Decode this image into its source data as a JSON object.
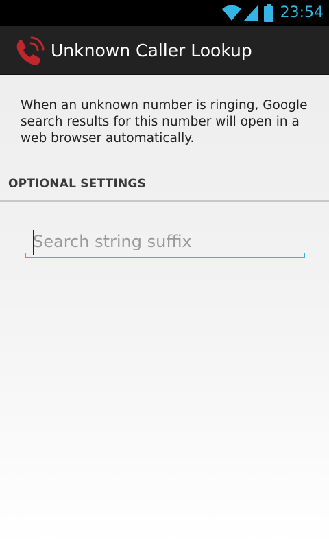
{
  "status_bar": {
    "time": "23:54",
    "icons": [
      "wifi-icon",
      "cell-signal-icon",
      "battery-icon"
    ],
    "accent_color": "#33b5e5"
  },
  "action_bar": {
    "app_icon": "phone-ringing-icon",
    "title": "Unknown Caller Lookup"
  },
  "main": {
    "description": "When an unknown number is ringing, Google search results for this number will open in a web browser automatically.",
    "section_header": "OPTIONAL SETTINGS",
    "search_suffix_field": {
      "value": "",
      "placeholder": "Search string suffix"
    }
  },
  "colors": {
    "accent": "#33b5e5",
    "action_bar_bg": "#222222",
    "status_bar_bg": "#000000",
    "icon_red": "#c0272d"
  }
}
